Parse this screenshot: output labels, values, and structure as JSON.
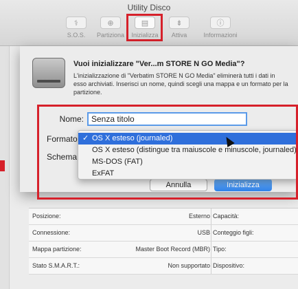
{
  "window": {
    "title": "Utility Disco"
  },
  "toolbar": {
    "buttons": [
      {
        "label": "S.O.S.",
        "icon": "stethoscope-icon"
      },
      {
        "label": "Partiziona",
        "icon": "partition-icon"
      },
      {
        "label": "Inizializza",
        "icon": "erase-icon"
      },
      {
        "label": "Attiva",
        "icon": "mount-icon"
      },
      {
        "label": "Informazioni",
        "icon": "info-icon"
      }
    ]
  },
  "sheet": {
    "title": "Vuoi inizializzare \"Ver...m STORE N GO Media\"?",
    "message": "L'inizializzazione di \"Verbatim STORE N GO Media\" eliminerà tutti i dati in esso archiviati. Inserisci un nome, quindi scegli una mappa e un formato per la partizione.",
    "name_label": "Nome:",
    "name_value": "Senza titolo",
    "format_label": "Formato",
    "scheme_label": "Schema",
    "cancel_label": "Annulla",
    "erase_label": "Inizializza"
  },
  "format_menu": {
    "check": "✓",
    "items": [
      "OS X esteso (journaled)",
      "OS X esteso (distingue tra maiuscole e minuscole, journaled)",
      "MS-DOS (FAT)",
      "ExFAT"
    ],
    "selected_index": 0
  },
  "info": {
    "rows": [
      {
        "key": "Posizione:",
        "value": "Esterno",
        "key2": "Capacità:"
      },
      {
        "key": "Connessione:",
        "value": "USB",
        "key2": "Conteggio figli:"
      },
      {
        "key": "Mappa partizione:",
        "value": "Master Boot Record (MBR)",
        "key2": "Tipo:"
      },
      {
        "key": "Stato S.M.A.R.T.:",
        "value": "Non supportato",
        "key2": "Dispositivo:"
      }
    ]
  },
  "colors": {
    "highlight": "#2f6fdb",
    "annotation": "#d6202a",
    "primary_button": "#2f81e8"
  }
}
